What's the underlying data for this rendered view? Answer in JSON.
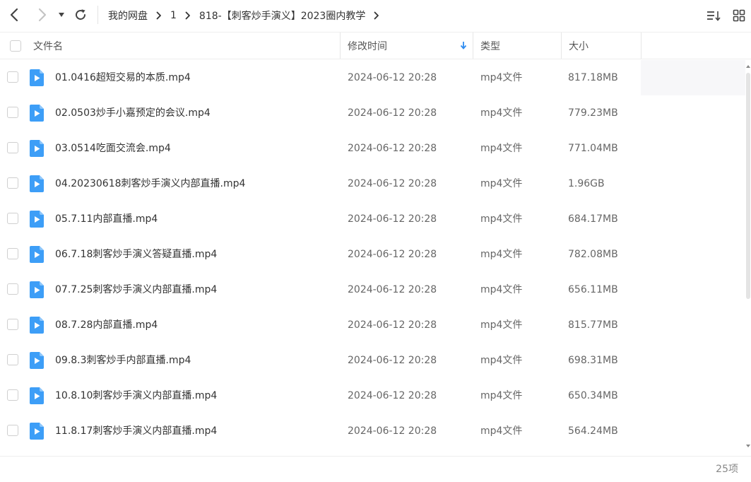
{
  "breadcrumb": [
    {
      "label": "我的网盘"
    },
    {
      "label": "1"
    },
    {
      "label": "818-【刺客炒手演义】2023圈内教学"
    }
  ],
  "columns": {
    "name": "文件名",
    "modified": "修改时间",
    "type": "类型",
    "size": "大小"
  },
  "files": [
    {
      "name": "01.0416超短交易的本质.mp4",
      "modified": "2024-06-12 20:28",
      "type": "mp4文件",
      "size": "817.18MB"
    },
    {
      "name": "02.0503炒手小嘉预定的会议.mp4",
      "modified": "2024-06-12 20:28",
      "type": "mp4文件",
      "size": "779.23MB"
    },
    {
      "name": "03.0514吃面交流会.mp4",
      "modified": "2024-06-12 20:28",
      "type": "mp4文件",
      "size": "771.04MB"
    },
    {
      "name": "04.20230618刺客炒手演义内部直播.mp4",
      "modified": "2024-06-12 20:28",
      "type": "mp4文件",
      "size": "1.96GB"
    },
    {
      "name": "05.7.11内部直播.mp4",
      "modified": "2024-06-12 20:28",
      "type": "mp4文件",
      "size": "684.17MB"
    },
    {
      "name": "06.7.18刺客炒手演义答疑直播.mp4",
      "modified": "2024-06-12 20:28",
      "type": "mp4文件",
      "size": "782.08MB"
    },
    {
      "name": "07.7.25刺客炒手演义内部直播.mp4",
      "modified": "2024-06-12 20:28",
      "type": "mp4文件",
      "size": "656.11MB"
    },
    {
      "name": "08.7.28内部直播.mp4",
      "modified": "2024-06-12 20:28",
      "type": "mp4文件",
      "size": "815.77MB"
    },
    {
      "name": "09.8.3刺客炒手内部直播.mp4",
      "modified": "2024-06-12 20:28",
      "type": "mp4文件",
      "size": "698.31MB"
    },
    {
      "name": "10.8.10刺客炒手演义内部直播.mp4",
      "modified": "2024-06-12 20:28",
      "type": "mp4文件",
      "size": "650.34MB"
    },
    {
      "name": "11.8.17刺客炒手演义内部直播.mp4",
      "modified": "2024-06-12 20:28",
      "type": "mp4文件",
      "size": "564.24MB"
    }
  ],
  "footer": {
    "count": "25项"
  },
  "icons": {
    "file_icon": "video-file-icon",
    "sort": "sort-down-arrow-icon"
  },
  "colors": {
    "file_icon_blue": "#3d9ef7",
    "sort_arrow_blue": "#2f8cf0"
  }
}
